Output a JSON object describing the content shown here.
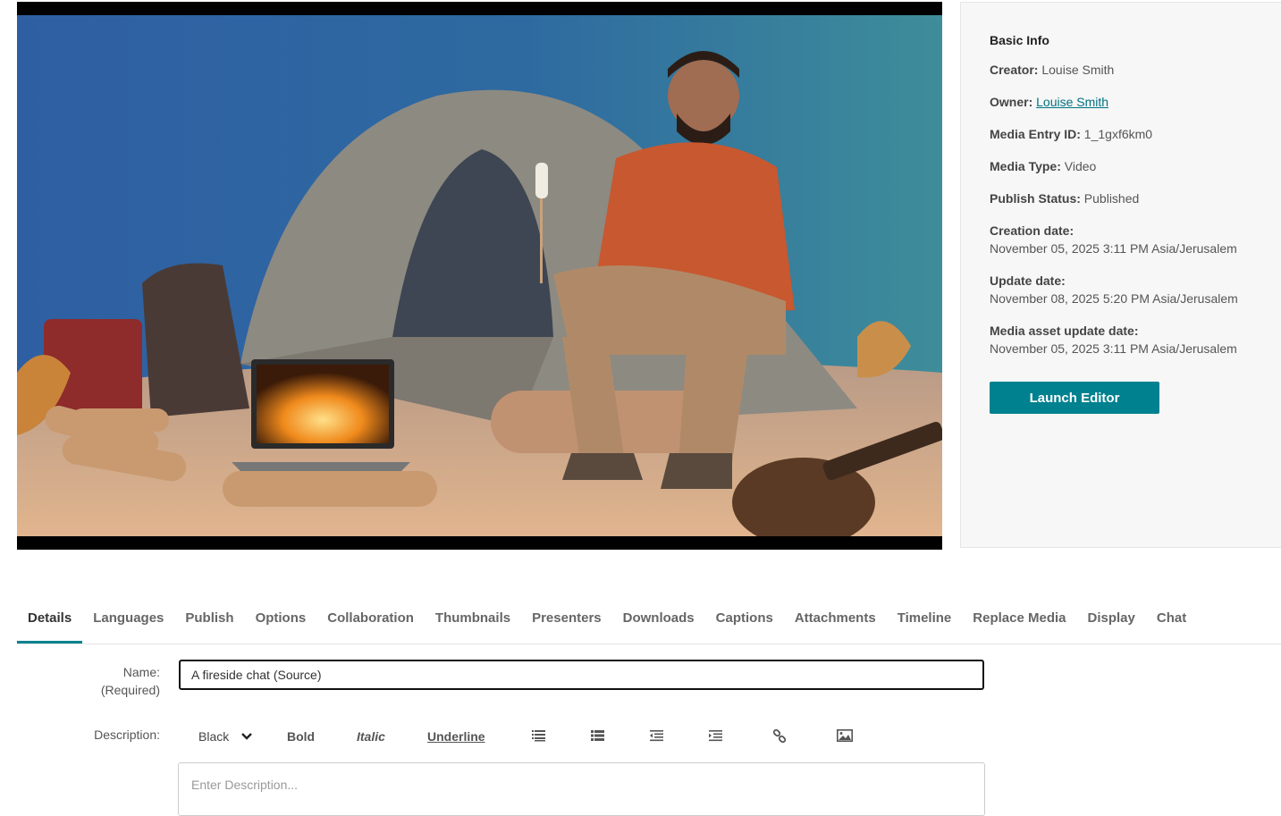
{
  "basic_info": {
    "title": "Basic Info",
    "creator_label": "Creator:",
    "creator_value": "Louise Smith",
    "owner_label": "Owner:",
    "owner_value": "Louise Smith",
    "entry_id_label": "Media Entry ID:",
    "entry_id_value": "1_1gxf6km0",
    "media_type_label": "Media Type:",
    "media_type_value": "Video",
    "publish_status_label": "Publish Status:",
    "publish_status_value": "Published",
    "creation_date_label": "Creation date:",
    "creation_date_value": "November 05, 2025 3:11 PM Asia/Jerusalem",
    "update_date_label": "Update date:",
    "update_date_value": "November 08, 2025 5:20 PM Asia/Jerusalem",
    "asset_update_label": "Media asset update date:",
    "asset_update_value": "November 05, 2025 3:11 PM Asia/Jerusalem",
    "launch_editor_label": "Launch Editor"
  },
  "tabs": [
    {
      "label": "Details",
      "active": true
    },
    {
      "label": "Languages"
    },
    {
      "label": "Publish"
    },
    {
      "label": "Options"
    },
    {
      "label": "Collaboration"
    },
    {
      "label": "Thumbnails"
    },
    {
      "label": "Presenters"
    },
    {
      "label": "Downloads"
    },
    {
      "label": "Captions"
    },
    {
      "label": "Attachments"
    },
    {
      "label": "Timeline"
    },
    {
      "label": "Replace Media"
    },
    {
      "label": "Display"
    },
    {
      "label": "Chat"
    }
  ],
  "form": {
    "name_label": "Name:",
    "name_required": "(Required)",
    "name_value": "A fireside chat (Source)",
    "description_label": "Description:",
    "description_placeholder": "Enter Description...",
    "toolbar": {
      "color_value": "Black",
      "bold_label": "Bold",
      "italic_label": "Italic",
      "underline_label": "Underline"
    }
  },
  "icons": {
    "chevron": "chevron-down-icon",
    "ordered_list": "ordered-list-icon",
    "bullet_list": "bullet-list-icon",
    "outdent": "outdent-icon",
    "indent": "indent-icon",
    "link": "link-icon",
    "image": "image-icon"
  },
  "colors": {
    "accent": "#00818f",
    "link": "#00727f"
  }
}
